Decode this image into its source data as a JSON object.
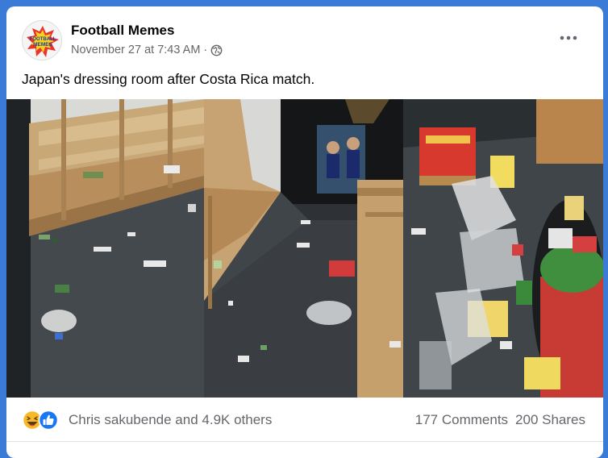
{
  "post": {
    "page_name": "Football Memes",
    "timestamp": "November 27 at 7:43 AM",
    "separator": "·",
    "text": "Japan's dressing room after Costa Rica match.",
    "avatar_text": "FOOTBALL MEMES"
  },
  "engagement": {
    "reactors": "Chris sakubende and 4.9K others",
    "comments": "177 Comments",
    "shares": "200 Shares",
    "reaction_icons": [
      "haha-icon",
      "like-icon"
    ]
  },
  "icons": {
    "privacy": "globe-icon",
    "menu": "more-options-icon"
  },
  "colors": {
    "background": "#3b7bd8",
    "card": "#ffffff",
    "like": "#1877f2",
    "haha": "#f7b928",
    "secondary_text": "#65676b"
  }
}
